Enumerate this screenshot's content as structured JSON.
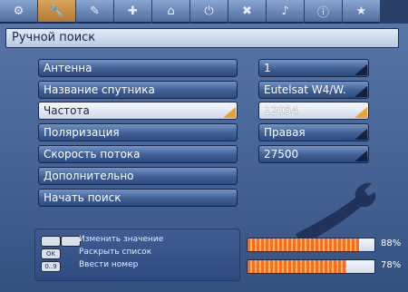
{
  "title": "Ручной поиск",
  "menu": [
    {
      "label": "Антенна"
    },
    {
      "label": "Название спутника"
    },
    {
      "label": "Частота"
    },
    {
      "label": "Поляризация"
    },
    {
      "label": "Скорость потока"
    },
    {
      "label": "Дополнительно"
    },
    {
      "label": "Начать поиск"
    }
  ],
  "values": [
    {
      "value": "1"
    },
    {
      "value": "Eutelsat W4/W."
    },
    {
      "value": "12054"
    },
    {
      "value": "Правая"
    },
    {
      "value": "27500"
    }
  ],
  "help": {
    "change_value": "Изменить значение",
    "ok_key": "OK",
    "open_list": "Раскрыть список",
    "num_key": "0..9",
    "enter_number": "Ввести номер"
  },
  "signal": {
    "strength_percent": 88,
    "strength_label": "88%",
    "quality_percent": 78,
    "quality_label": "78%"
  },
  "colors": {
    "accent": "#f0a02a",
    "bar_fill": "#ff6a21",
    "background": "#4b6a9c"
  }
}
